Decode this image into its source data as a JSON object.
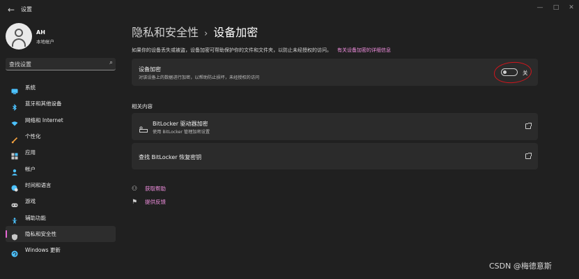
{
  "app": {
    "title": "设置"
  },
  "profile": {
    "name": "AH",
    "subtitle": "本地帐户"
  },
  "search": {
    "placeholder": "查找设置"
  },
  "sidebar": {
    "items": [
      {
        "label": "系统",
        "icon": "monitor-icon",
        "color": "#4cc2ff"
      },
      {
        "label": "蓝牙和其他设备",
        "icon": "bluetooth-icon",
        "color": "#4cc2ff"
      },
      {
        "label": "网络和 Internet",
        "icon": "wifi-icon",
        "color": "#4cc2ff"
      },
      {
        "label": "个性化",
        "icon": "brush-icon",
        "color": "#f7a440"
      },
      {
        "label": "应用",
        "icon": "apps-icon",
        "color": "#c7c7c7"
      },
      {
        "label": "帐户",
        "icon": "person-icon",
        "color": "#4cc2ff"
      },
      {
        "label": "时间和语言",
        "icon": "globe-clock-icon",
        "color": "#4cc2ff"
      },
      {
        "label": "游戏",
        "icon": "gamepad-icon",
        "color": "#c7c7c7"
      },
      {
        "label": "辅助功能",
        "icon": "accessibility-icon",
        "color": "#4cc2ff"
      },
      {
        "label": "隐私和安全性",
        "icon": "shield-icon",
        "color": "#c7c7c7",
        "active": true
      },
      {
        "label": "Windows 更新",
        "icon": "update-icon",
        "color": "#4cc2ff"
      }
    ]
  },
  "main": {
    "breadcrumb_parent": "隐私和安全性",
    "breadcrumb_sep": "›",
    "breadcrumb_current": "设备加密",
    "description": "如果你的设备丢失或被盗，设备加密可帮助保护你的文件和文件夹，以防止未经授权的访问。",
    "description_link": "有关设备加密的详细信息",
    "encryption_card": {
      "title": "设备加密",
      "subtitle": "对该设备上的数据进行加密，以帮助防止损坏，未经授权的访问",
      "toggle_state": "关"
    },
    "related_title": "相关内容",
    "bitlocker_card": {
      "title": "BitLocker 驱动器加密",
      "subtitle": "使用 BitLocker 管理加密设置"
    },
    "recovery_card": {
      "title": "查找 BitLocker 恢复密钥"
    },
    "help_link": "获取帮助",
    "feedback_link": "提供反馈"
  },
  "watermark": "CSDN @梅德意斯",
  "colors": {
    "accent": "#f28fe0",
    "highlight": "#d0161d",
    "background": "#202020"
  }
}
